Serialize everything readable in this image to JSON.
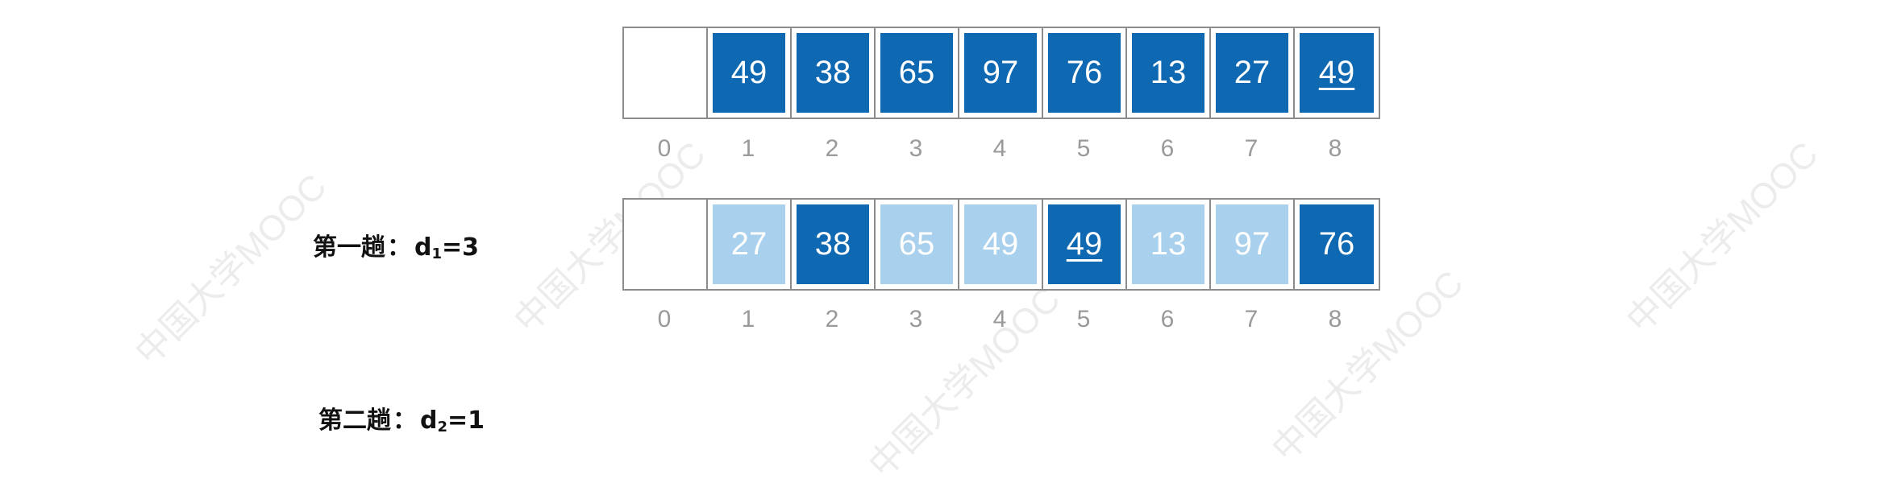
{
  "watermark_text": "中国大学MOOC",
  "indices": [
    "0",
    "1",
    "2",
    "3",
    "4",
    "5",
    "6",
    "7",
    "8"
  ],
  "rows": [
    {
      "cells": [
        {
          "value": "",
          "style": "empty",
          "underline": false
        },
        {
          "value": "49",
          "style": "dark",
          "underline": false
        },
        {
          "value": "38",
          "style": "dark",
          "underline": false
        },
        {
          "value": "65",
          "style": "dark",
          "underline": false
        },
        {
          "value": "97",
          "style": "dark",
          "underline": false
        },
        {
          "value": "76",
          "style": "dark",
          "underline": false
        },
        {
          "value": "13",
          "style": "dark",
          "underline": false
        },
        {
          "value": "27",
          "style": "dark",
          "underline": false
        },
        {
          "value": "49",
          "style": "dark",
          "underline": true
        }
      ]
    },
    {
      "cells": [
        {
          "value": "",
          "style": "empty",
          "underline": false
        },
        {
          "value": "27",
          "style": "light",
          "underline": false
        },
        {
          "value": "38",
          "style": "dark",
          "underline": false
        },
        {
          "value": "65",
          "style": "light",
          "underline": false
        },
        {
          "value": "49",
          "style": "light",
          "underline": false
        },
        {
          "value": "49",
          "style": "dark",
          "underline": true
        },
        {
          "value": "13",
          "style": "light",
          "underline": false
        },
        {
          "value": "97",
          "style": "light",
          "underline": false
        },
        {
          "value": "76",
          "style": "dark",
          "underline": false
        }
      ]
    }
  ],
  "pass1": {
    "prefix": "第一趟",
    "colon": "：",
    "var": "d",
    "sub": "1",
    "suffix": "=3"
  },
  "pass2": {
    "prefix": "第二趟",
    "colon": "：",
    "var": "d",
    "sub": "2",
    "suffix": "=1"
  },
  "colors": {
    "dark": "#0f68b2",
    "light": "#a9d0ec",
    "border": "#8c8c8c",
    "index": "#9a9a9a"
  }
}
